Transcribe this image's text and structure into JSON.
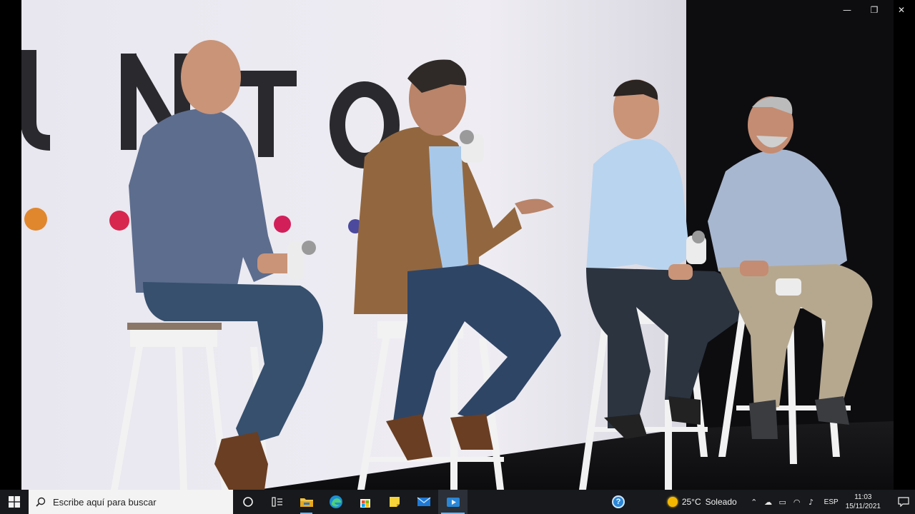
{
  "window": {
    "controls": {
      "minimize": "—",
      "restore": "❐",
      "close": "✕"
    }
  },
  "video": {
    "backdrop_text": "U N T O"
  },
  "taskbar": {
    "search_placeholder": "Escribe aquí para buscar",
    "apps": [
      "task-view",
      "file-explorer",
      "edge",
      "store",
      "sticky-notes",
      "mail",
      "video-player"
    ],
    "weather": {
      "temperature": "25°C",
      "condition": "Soleado"
    },
    "language": "ESP",
    "time": "11:03",
    "date": "15/11/2021"
  },
  "colors": {
    "taskbar": "#17191c",
    "accent": "#6cb8f6",
    "weather_sun": "#f5b800"
  }
}
